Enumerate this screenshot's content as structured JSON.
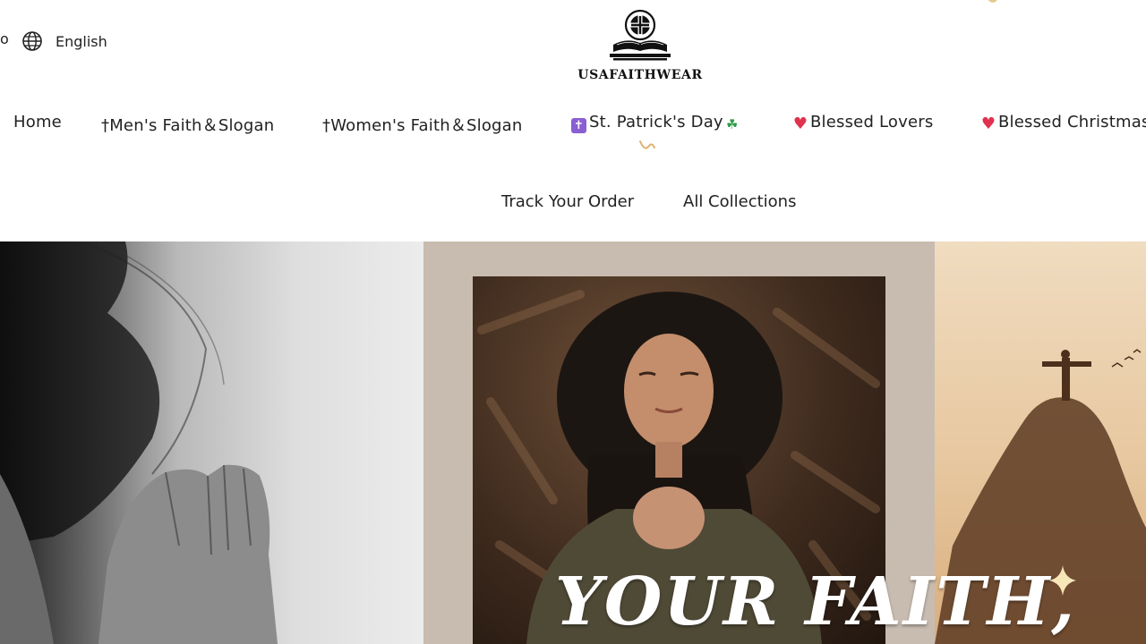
{
  "header": {
    "language_cut_label": "o",
    "language_label": "English",
    "logo_text": "USAFAITHWEAR"
  },
  "nav": {
    "items": [
      {
        "label": "Home"
      },
      {
        "label": "†Men's Faith＆Slogan"
      },
      {
        "label": "†Women's Faith＆Slogan"
      },
      {
        "label": "St. Patrick's Day"
      },
      {
        "label": "Blessed Lovers"
      },
      {
        "label": "Blessed Christmas"
      }
    ],
    "second_row": [
      {
        "label": "Track Your Order"
      },
      {
        "label": "All Collections"
      }
    ]
  },
  "hero": {
    "headline": "YOUR FAITH,"
  },
  "colors": {
    "text": "#1a1a1a",
    "mid_panel_bg": "#c8bcb0",
    "right_panel_bg": "#e7c79f",
    "heart": "#e0314f",
    "cross_badge": "#8a5fd1",
    "clover": "#2e9b48",
    "sparkle": "#f6e6b8"
  },
  "icons": [
    "globe-icon",
    "logo-cross-book-icon",
    "cross-emoji-icon",
    "clover-emoji-icon",
    "heart-emoji-icon",
    "sparkle-icon"
  ]
}
